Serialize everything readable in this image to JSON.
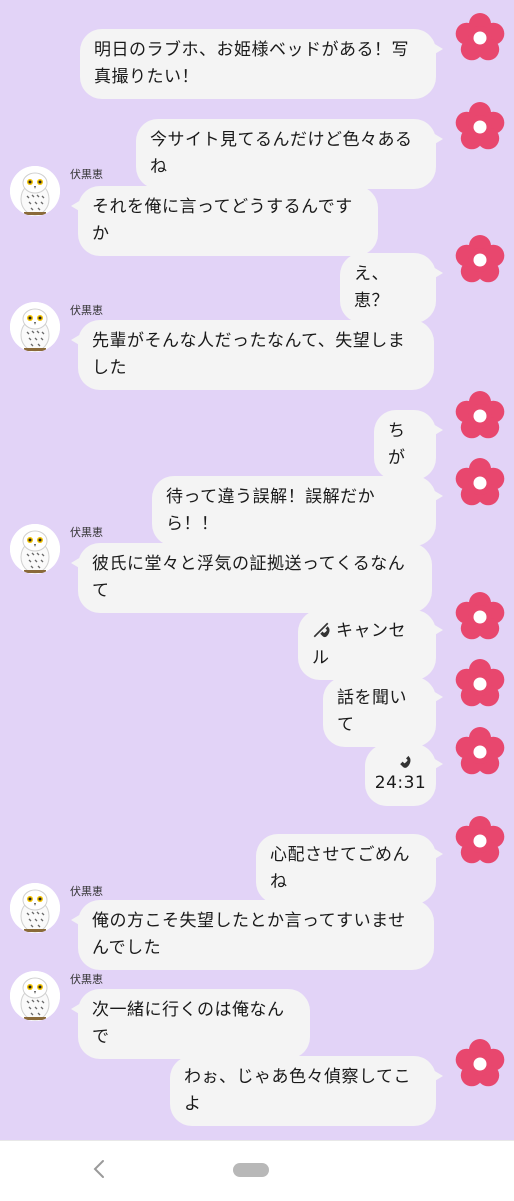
{
  "sender_name": "伏黒恵",
  "messages": [
    {
      "side": "right",
      "text": "明日のラブホ、お姫様ベッドがある！写真撮りたい！"
    },
    {
      "side": "right",
      "text": "今サイト見てるんだけど色々あるね"
    },
    {
      "side": "left",
      "text": "それを俺に言ってどうするんですか"
    },
    {
      "side": "right",
      "text": "え、恵？"
    },
    {
      "side": "left",
      "text": "先輩がそんな人だったなんて、失望しました"
    },
    {
      "side": "right",
      "text": "ちが"
    },
    {
      "side": "right",
      "text": "待って違う誤解！誤解だから！！"
    },
    {
      "side": "left",
      "text": "彼氏に堂々と浮気の証拠送ってくるなんて"
    },
    {
      "side": "right",
      "text": "キャンセル",
      "type": "call-cancelled"
    },
    {
      "side": "right",
      "text": "話を聞いて"
    },
    {
      "side": "right",
      "text": "24:31",
      "type": "call-duration"
    },
    {
      "side": "right",
      "text": "心配させてごめんね"
    },
    {
      "side": "left",
      "text": "俺の方こそ失望したとか言ってすいませんでした"
    },
    {
      "side": "left",
      "text": "次一緒に行くのは俺なんで"
    },
    {
      "side": "right",
      "text": "わぉ、じゃあ色々偵察してこよ"
    }
  ],
  "colors": {
    "chat_background": "#e2d3f7",
    "bubble": "#f4f4f4",
    "flower_petal": "#e8476e"
  },
  "icons": {
    "self_avatar": "pink-flower-icon",
    "other_avatar": "owl-icon",
    "call": "phone-icon",
    "back": "chevron-left-icon"
  }
}
